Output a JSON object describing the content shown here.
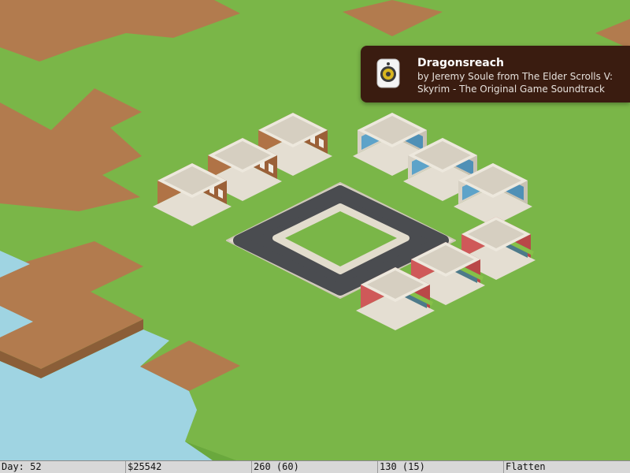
{
  "notification": {
    "title": "Dragonsreach",
    "body": "by Jeremy Soule from The Elder Scrolls V: Skyrim - The Original Game Soundtrack",
    "icon": "speaker-icon"
  },
  "status_bar": {
    "day": "Day: 52",
    "money": "$25542",
    "population": "260 (60)",
    "jobs": "130 (15)",
    "tool": "Flatten"
  },
  "colors": {
    "grass": "#7ab648",
    "dirt": "#b27b4e",
    "water": "#9fd4e2",
    "road": "#4a4c50",
    "brick": "#a9693e",
    "shop_red": "#c24e4e",
    "awning_green": "#86c048"
  }
}
